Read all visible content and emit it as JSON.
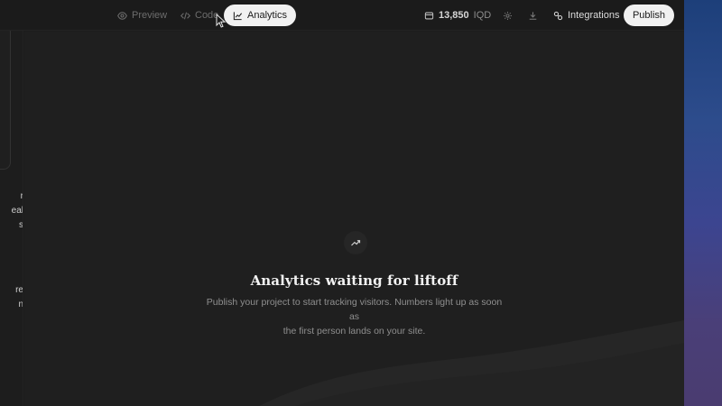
{
  "toolbar": {
    "tabs": [
      {
        "label": "Preview",
        "icon": "eye-icon"
      },
      {
        "label": "Code",
        "icon": "code-icon"
      },
      {
        "label": "Analytics",
        "icon": "line-chart-icon",
        "active": true
      }
    ],
    "credits": {
      "amount": "13,850",
      "currency": "IQD",
      "icon": "wallet-icon"
    },
    "settings_icon": "gear-icon",
    "download_icon": "download-icon",
    "integrations_label": "Integrations",
    "integrations_icon": "plug-icon",
    "publish_label": "Publish"
  },
  "left_panel": {
    "text_fragments_1": [
      "r",
      "eal",
      "s"
    ],
    "text_fragments_2": [
      "re",
      "n"
    ]
  },
  "empty_state": {
    "icon": "trend-up-icon",
    "title": "Analytics waiting for liftoff",
    "description_line1": "Publish your project to start tracking visitors. Numbers light up as soon as",
    "description_line2": "the first person lands on your site."
  },
  "colors": {
    "background": "#1f1f1f",
    "topbar": "#1b1b1b",
    "active_tab": "#f1f1f1",
    "muted_text": "#8f8f8f"
  }
}
